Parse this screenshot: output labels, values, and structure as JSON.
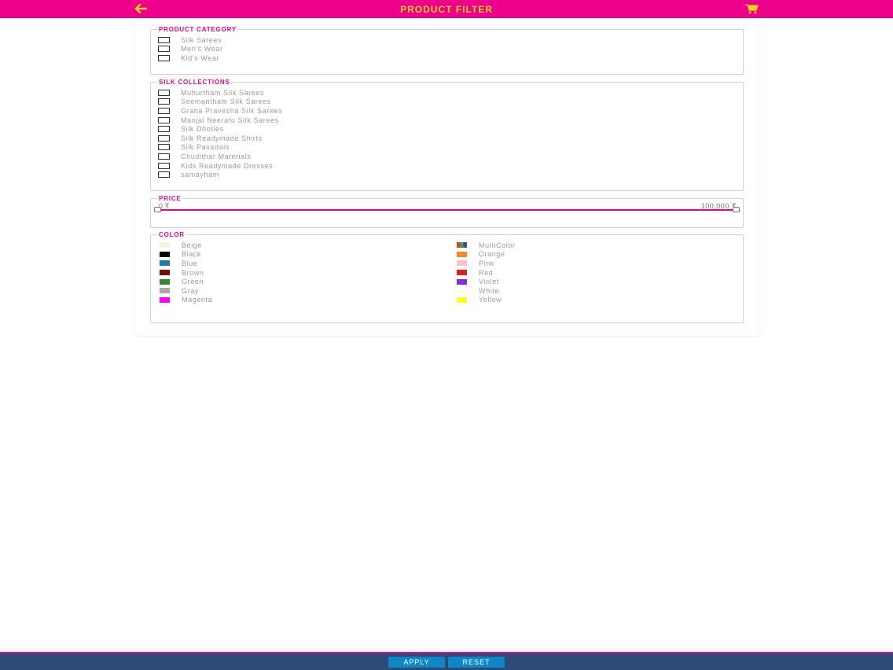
{
  "header": {
    "title": "PRODUCT FILTER",
    "back_icon": "arrow-left-icon",
    "cart_icon": "shopping-cart-icon",
    "accent_color": "#ec008c",
    "title_color": "#ffd11a"
  },
  "product_category": {
    "legend": "PRODUCT CATEGORY",
    "items": [
      {
        "label": "Silk Sarees",
        "checked": false
      },
      {
        "label": "Men's Wear",
        "checked": false
      },
      {
        "label": "Kid's Wear",
        "checked": false
      }
    ]
  },
  "silk_collections": {
    "legend": "SILK COLLECTIONS",
    "items": [
      {
        "label": "Muhurtham Silk Sarees",
        "checked": false
      },
      {
        "label": "Seemantham Silk Sarees",
        "checked": false
      },
      {
        "label": "Graha Pravesha Silk Sarees",
        "checked": false
      },
      {
        "label": "Manjal Neeratu Silk Sarees",
        "checked": false
      },
      {
        "label": "Silk Dhoties",
        "checked": false
      },
      {
        "label": "Silk Readymade Shirts",
        "checked": false
      },
      {
        "label": "Silk Pavadais",
        "checked": false
      },
      {
        "label": "Chudithar Materials",
        "checked": false
      },
      {
        "label": "Kids Readymade Dresses",
        "checked": false
      },
      {
        "label": "samayham",
        "checked": false
      }
    ]
  },
  "price": {
    "legend": "PRICE",
    "min_label": "0 ₹",
    "max_label": "100,000 ₹",
    "min_value": 0,
    "max_value": 100000
  },
  "color": {
    "legend": "COLOR",
    "left": [
      {
        "label": "Beige",
        "hex": "#f5f5dc"
      },
      {
        "label": "Black",
        "hex": "#000000"
      },
      {
        "label": "Blue",
        "hex": "#1f7ab5"
      },
      {
        "label": "Brown",
        "hex": "#7a0a0a"
      },
      {
        "label": "Green",
        "hex": "#2e8b2e"
      },
      {
        "label": "Gray",
        "hex": "#a9a9a9"
      },
      {
        "label": "Magenta",
        "hex": "#ff00ff"
      }
    ],
    "right": [
      {
        "label": "MultiColor",
        "hex": "multi"
      },
      {
        "label": "Orange",
        "hex": "#f08a24"
      },
      {
        "label": "Pink",
        "hex": "#ffc0cb"
      },
      {
        "label": "Red",
        "hex": "#e0201b"
      },
      {
        "label": "Violet",
        "hex": "#8a2be2"
      },
      {
        "label": "White",
        "hex": "#ffffff"
      },
      {
        "label": "Yellow",
        "hex": "#ffff1a"
      }
    ]
  },
  "footer": {
    "apply_label": "APPLY",
    "reset_label": "RESET"
  }
}
